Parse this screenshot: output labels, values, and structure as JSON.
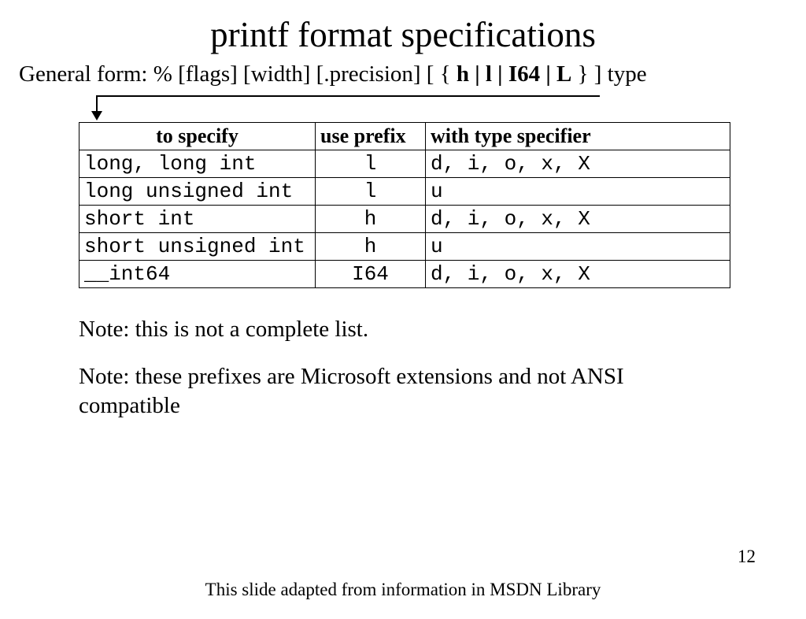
{
  "title": "printf format specifications",
  "general_form": {
    "prefix": "General form:  % [flags] [width] [.precision] [ { ",
    "bold": "h | l | I64 | L",
    "suffix": " } ] type"
  },
  "table": {
    "headers": [
      "to specify",
      "use prefix",
      "with type specifier"
    ],
    "rows": [
      {
        "specify": "long, long int",
        "prefix": "l",
        "typespec": "d, i, o, x, X"
      },
      {
        "specify": "long unsigned int",
        "prefix": "l",
        "typespec": "u"
      },
      {
        "specify": "short int",
        "prefix": "h",
        "typespec": "d, i, o, x, X"
      },
      {
        "specify": "short unsigned int",
        "prefix": "h",
        "typespec": "u"
      },
      {
        "specify": "__int64",
        "prefix": "I64",
        "typespec": "d, i, o, x, X"
      }
    ]
  },
  "notes": [
    "Note:  this is not a complete list.",
    "Note:  these prefixes are Microsoft extensions and not ANSI compatible"
  ],
  "footer": "This slide adapted from information in MSDN Library",
  "page_number": "12"
}
